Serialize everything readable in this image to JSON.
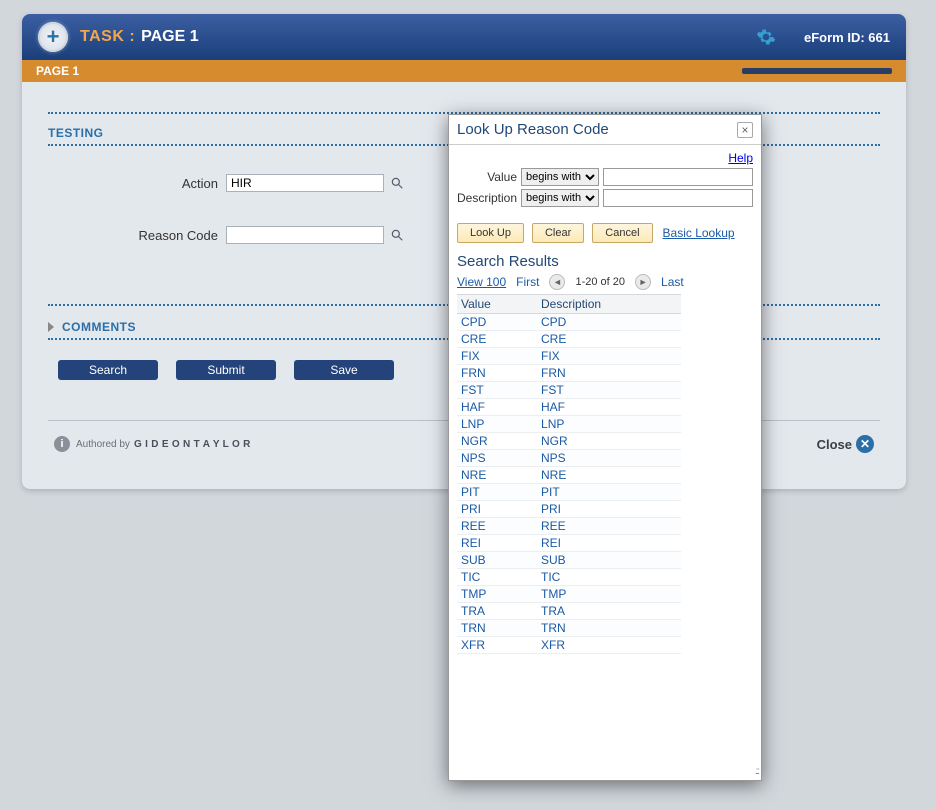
{
  "header": {
    "task_label": "TASK :",
    "page_label": "PAGE 1",
    "eform_id": "eForm ID: 661"
  },
  "orange_bar": {
    "page_label": "PAGE 1"
  },
  "testing_section": {
    "label": "TESTING",
    "action_label": "Action",
    "action_value": "HIR",
    "reason_label": "Reason Code",
    "reason_value": ""
  },
  "comments_section": {
    "label": "COMMENTS"
  },
  "buttons": {
    "search": "Search",
    "submit": "Submit",
    "save": "Save"
  },
  "footer": {
    "authored": "Authored by",
    "brand": "G I D E O N  T A Y L O R",
    "close": "Close"
  },
  "modal": {
    "title": "Look Up Reason Code",
    "help": "Help",
    "value_label": "Value",
    "desc_label": "Description",
    "op_begins": "begins with",
    "lookup": "Look Up",
    "clear": "Clear",
    "cancel": "Cancel",
    "basic": "Basic Lookup",
    "sr_title": "Search Results",
    "view100": "View 100",
    "first": "First",
    "range": "1-20 of 20",
    "last": "Last",
    "col_value": "Value",
    "col_desc": "Description",
    "rows": [
      {
        "v": "CPD",
        "d": "CPD"
      },
      {
        "v": "CRE",
        "d": "CRE"
      },
      {
        "v": "FIX",
        "d": "FIX"
      },
      {
        "v": "FRN",
        "d": "FRN"
      },
      {
        "v": "FST",
        "d": "FST"
      },
      {
        "v": "HAF",
        "d": "HAF"
      },
      {
        "v": "LNP",
        "d": "LNP"
      },
      {
        "v": "NGR",
        "d": "NGR"
      },
      {
        "v": "NPS",
        "d": "NPS"
      },
      {
        "v": "NRE",
        "d": "NRE"
      },
      {
        "v": "PIT",
        "d": "PIT"
      },
      {
        "v": "PRI",
        "d": "PRI"
      },
      {
        "v": "REE",
        "d": "REE"
      },
      {
        "v": "REI",
        "d": "REI"
      },
      {
        "v": "SUB",
        "d": "SUB"
      },
      {
        "v": "TIC",
        "d": "TIC"
      },
      {
        "v": "TMP",
        "d": "TMP"
      },
      {
        "v": "TRA",
        "d": "TRA"
      },
      {
        "v": "TRN",
        "d": "TRN"
      },
      {
        "v": "XFR",
        "d": "XFR"
      }
    ]
  }
}
